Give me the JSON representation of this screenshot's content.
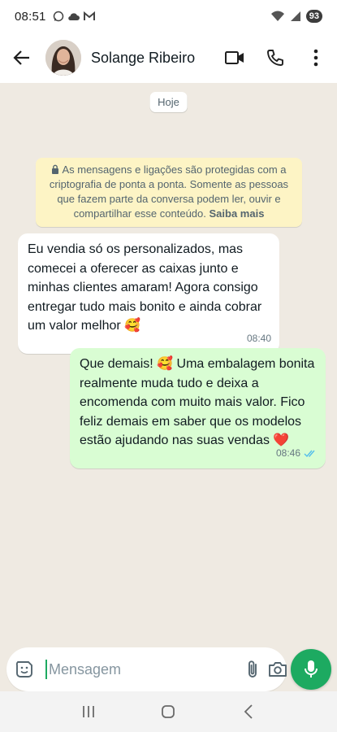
{
  "status_bar": {
    "time": "08:51",
    "battery": "93"
  },
  "header": {
    "contact_name": "Solange Ribeiro"
  },
  "chat": {
    "day_label": "Hoje",
    "encryption_notice": {
      "text": "As mensagens e ligações são protegidas com a criptografia de ponta a ponta. Somente as pessoas que fazem parte da conversa podem ler, ouvir e compartilhar esse conteúdo.",
      "link": "Saiba mais"
    },
    "messages": [
      {
        "direction": "incoming",
        "text": "Eu vendia só os personalizados, mas comecei a oferecer as caixas junto e minhas clientes amaram! Agora consigo entregar tudo mais bonito e ainda cobrar um valor melhor 🥰",
        "time": "08:40"
      },
      {
        "direction": "outgoing",
        "text": "Que demais! 🥰 Uma embalagem bonita realmente muda tudo e deixa a encomenda com muito mais valor. Fico feliz demais em saber que os modelos estão ajudando nas suas vendas ❤️",
        "time": "08:46",
        "status": "read"
      }
    ]
  },
  "composer": {
    "placeholder": "Mensagem"
  },
  "colors": {
    "accent": "#1daa61",
    "outgoing_bubble": "#d9fdd3",
    "chat_background": "#efeae2",
    "read_ticks": "#53bdeb"
  }
}
